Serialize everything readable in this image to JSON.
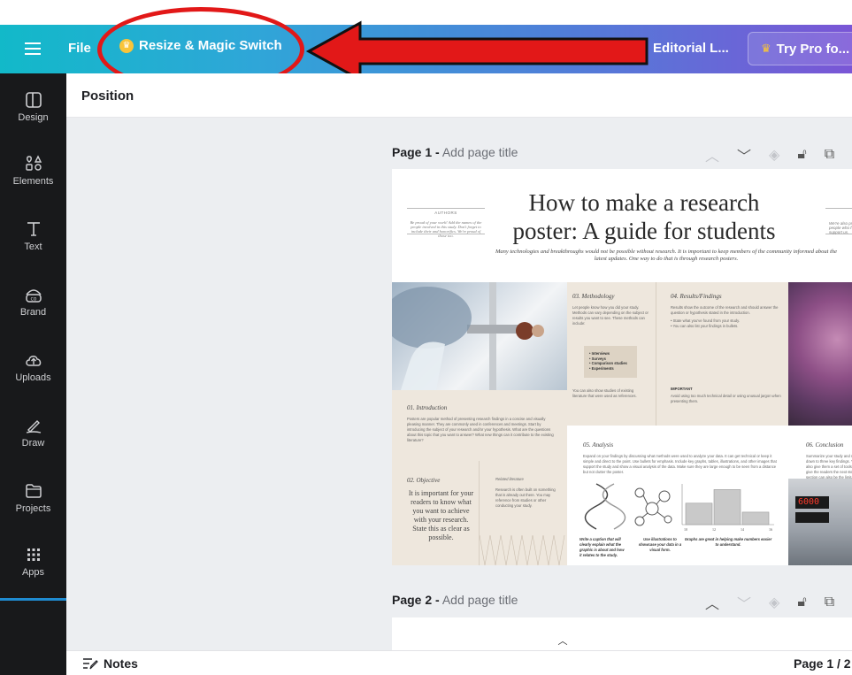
{
  "header": {
    "file_label": "File",
    "resize_label": "Resize & Magic Switch",
    "doc_title": "Editorial L...",
    "try_pro_label": "Try Pro fo..."
  },
  "sidebar": {
    "items": [
      {
        "label": "Design",
        "icon": "layout-icon"
      },
      {
        "label": "Elements",
        "icon": "shapes-icon"
      },
      {
        "label": "Text",
        "icon": "text-icon"
      },
      {
        "label": "Brand",
        "icon": "brand-icon"
      },
      {
        "label": "Uploads",
        "icon": "upload-cloud-icon"
      },
      {
        "label": "Draw",
        "icon": "draw-icon"
      },
      {
        "label": "Projects",
        "icon": "folder-icon"
      },
      {
        "label": "Apps",
        "icon": "apps-grid-icon"
      }
    ]
  },
  "panel": {
    "title": "Position"
  },
  "pages": [
    {
      "num": "Page 1 -",
      "add_title": "Add page title"
    },
    {
      "num": "Page 2 -",
      "add_title": "Add page title"
    }
  ],
  "poster": {
    "title": "How to make a research poster: A guide for students",
    "subtitle": "Many technologies and breakthroughs would not be possible without research. It is important to keep members of the community informed about the latest updates. One way to do that is through research posters.",
    "authors_label": "AUTHORS",
    "authors_text": "Be proud of your work! Add the names of the people involved in this study. Don't forget to include their and honorifics. We're proud of those too.",
    "right_text": "We're also proud of the people who helped and support us.",
    "methodology_h": "03. Methodology",
    "methodology_p": "Let people know how you did your study. Methods can vary depending on the subject or results you want to see. These methods can include:",
    "methodology_list": [
      "• Interviews",
      "• Surveys",
      "• Comparison studies",
      "• Experiments"
    ],
    "methodology_p2": "You can also show studies of existing literature that were used as references.",
    "results_h": "04. Results/Findings",
    "results_p": "Results show the outcome of the research and should answer the question or hypothesis stated in the introduction.",
    "results_bullets": [
      "• State what you've found from your study.",
      "• You can also list your findings in bullets."
    ],
    "important_h": "IMPORTANT",
    "important_p": "Avoid using too much technical detail or using unusual jargon when presenting them.",
    "intro_h": "01. Introduction",
    "intro_p": "Posters are popular method of presenting research findings in a concise and visually pleasing manner. They are commonly used in conferences and meetings. Start by introducing the subject of your research and/or your hypothesis. What are the questions about this topic that you want to answer? What new things can it contribute to the existing literature?",
    "analysis_h": "05. Analysis",
    "analysis_p": "Expand on your findings by discussing what methods were used to analyze your data. It can get technical or keep it simple and direct to the point. Use bullets for emphasis. Include key graphs, tables, illustrations, and other images that support the study and show a visual analysis of the data. Make sure they are large enough to be seen from a distance but not clutter the poster.",
    "conclusion_h": "06. Conclusion",
    "conclusion_p": "Summarize your study and narrow it down to three key findings. You can also give them a set of tools that can give the readers the next step. This section can also be the limitations of the study, and if there are any recommendations for future research.",
    "objective_h": "02. Objective",
    "objective_p": "It is important for your readers to know what you want to achieve with your research. State this as clear as possible.",
    "related_h": "Related literature",
    "related_p": "Research is often built on something that is already out there. You may reference from studies or other conducting your study.",
    "caption_dna": "Write a caption that will clearly explain what the graphic is about and how it relates to the study.",
    "caption_molecule": "Use illustrations to showcase your data in a visual form.",
    "caption_graph": "Graphs are great in helping make numbers easier to understand.",
    "graph_x": [
      "10",
      "12",
      "14",
      "16"
    ],
    "graph_values": [
      0.55,
      0.9,
      0.32
    ],
    "device_display": "6000"
  },
  "footer": {
    "notes_label": "Notes",
    "page_count": "Page 1 / 2"
  },
  "colors": {
    "annotation_red": "#e21818",
    "gradient_start": "#12b9c9",
    "gradient_end": "#7a56d6"
  }
}
